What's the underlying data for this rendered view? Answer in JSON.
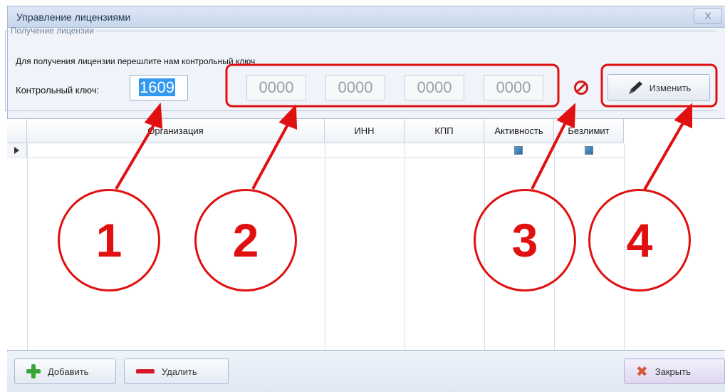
{
  "window": {
    "title": "Управление лицензиями",
    "close_label": "X"
  },
  "license": {
    "group_title": "Получение лицензии",
    "hint": "Для получения лицензии перешлите нам контрольный ключ",
    "key_label": "Контрольный ключ:",
    "key_value": "1609",
    "codes": [
      "0000",
      "0000",
      "0000",
      "0000"
    ],
    "status_icon": "no-entry-icon",
    "change_label": "Изменить"
  },
  "grid": {
    "columns": [
      "Организация",
      "ИНН",
      "КПП",
      "Активность",
      "Безлимит"
    ],
    "rows": [
      {
        "org": "",
        "inn": "",
        "kpp": "",
        "active": true,
        "unlimited": true
      }
    ]
  },
  "footer": {
    "add_label": "Добавить",
    "delete_label": "Удалить",
    "close_label": "Закрыть"
  },
  "annotations": [
    "1",
    "2",
    "3",
    "4"
  ],
  "colors": {
    "annotation": "#e01010",
    "accent": "#3398f0"
  }
}
